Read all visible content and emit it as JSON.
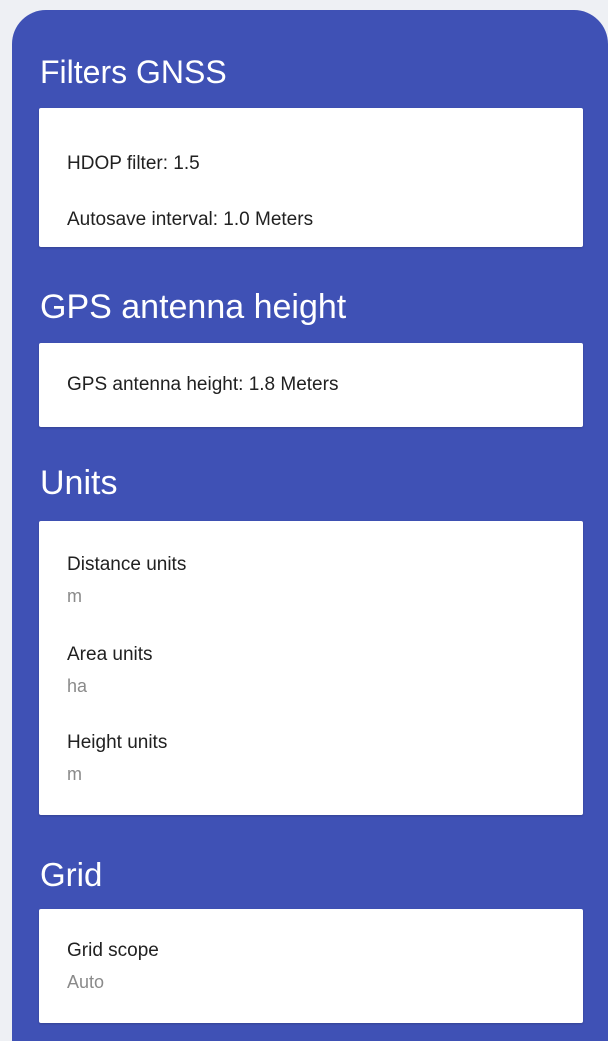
{
  "sections": {
    "filters": {
      "title": "Filters GNSS",
      "hdop": "HDOP filter: 1.5",
      "autosave": "Autosave interval: 1.0 Meters"
    },
    "antenna": {
      "title": "GPS antenna height",
      "height": "GPS antenna height: 1.8 Meters"
    },
    "units": {
      "title": "Units",
      "distance_label": "Distance units",
      "distance_value": "m",
      "area_label": "Area units",
      "area_value": "ha",
      "height_label": "Height units",
      "height_value": "m"
    },
    "grid": {
      "title": "Grid",
      "scope_label": "Grid scope",
      "scope_value": "Auto"
    }
  },
  "colors": {
    "header": "#3f51b5",
    "card": "#ffffff",
    "primary_text": "#212121",
    "secondary_text": "#8a8a8a"
  }
}
